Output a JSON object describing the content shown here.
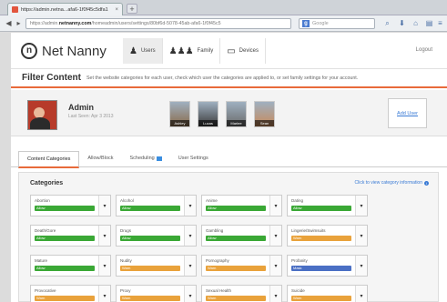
{
  "browser": {
    "tab_title": "https://admin.netna...afa6-1f0f45c5dfa1",
    "new_tab": "+",
    "url_prefix": "https://admin.",
    "url_host": "netnanny.com",
    "url_rest": "/homeadmin/users/settings/80bf6d-5078-45ab-afa6-1f0f45c5",
    "search_placeholder": "Google"
  },
  "header": {
    "logo_text": "Net Nanny",
    "nav": [
      {
        "label": "Users"
      },
      {
        "label": "Family"
      },
      {
        "label": "Devices"
      }
    ],
    "logout": "Logout"
  },
  "subheader": {
    "title": "Filter Content",
    "description": "Set the website categories for each user, check which user the categories are applied to, or set family settings for your account."
  },
  "user": {
    "name": "Admin",
    "last_seen": "Last Seen: Apr 3 2013",
    "others": [
      {
        "name": "Ashley",
        "color": "#8a6a4a"
      },
      {
        "name": "Lucas",
        "color": "#3a3a3a"
      },
      {
        "name": "Marlee",
        "color": "#6a6a6a"
      },
      {
        "name": "Sean",
        "color": "#c88a5a"
      }
    ],
    "add_user": "Add User"
  },
  "tabs": [
    {
      "label": "Content Categories"
    },
    {
      "label": "Allow/Block"
    },
    {
      "label": "Scheduling"
    },
    {
      "label": "User Settings"
    }
  ],
  "categories": {
    "title": "Categories",
    "info_link": "Click to view category information",
    "items": [
      {
        "name": "Abortion",
        "status": "Allow",
        "color": "#3aa835"
      },
      {
        "name": "Alcohol",
        "status": "Allow",
        "color": "#3aa835"
      },
      {
        "name": "Anime",
        "status": "Allow",
        "color": "#3aa835"
      },
      {
        "name": "Dating",
        "status": "Allow",
        "color": "#3aa835"
      },
      {
        "name": "Death/Gore",
        "status": "Allow",
        "color": "#3aa835"
      },
      {
        "name": "Drugs",
        "status": "Allow",
        "color": "#3aa835"
      },
      {
        "name": "Gambling",
        "status": "Allow",
        "color": "#3aa835"
      },
      {
        "name": "Lingerie/Swimsuits",
        "status": "Warn",
        "color": "#e9a23b"
      },
      {
        "name": "Mature",
        "status": "Allow",
        "color": "#3aa835"
      },
      {
        "name": "Nudity",
        "status": "Warn",
        "color": "#e9a23b"
      },
      {
        "name": "Pornography",
        "status": "Warn",
        "color": "#e9a23b"
      },
      {
        "name": "Profanity",
        "status": "Mask",
        "color": "#4a6fc4"
      },
      {
        "name": "Provocative",
        "status": "Warn",
        "color": "#e9a23b"
      },
      {
        "name": "Proxy",
        "status": "Warn",
        "color": "#e9a23b"
      },
      {
        "name": "Sexual Health",
        "status": "Warn",
        "color": "#e9a23b"
      },
      {
        "name": "Suicide",
        "status": "Warn",
        "color": "#e9a23b"
      }
    ]
  }
}
